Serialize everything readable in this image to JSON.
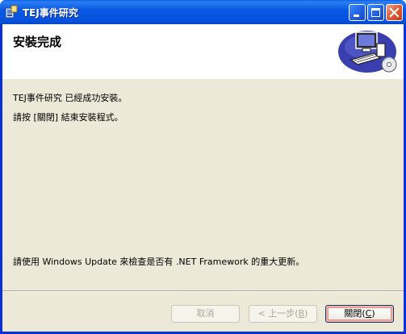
{
  "window": {
    "title": "TEJ事件研究"
  },
  "header": {
    "title": "安裝完成"
  },
  "messages": {
    "installed": "TEJ事件研究 已經成功安裝。",
    "close_hint": "請按 [關閉] 結束安裝程式。",
    "update_hint": "請使用 Windows Update 來檢查是否有 .NET Framework 的重大更新。"
  },
  "buttons": {
    "cancel": "取消",
    "back_prefix": "< 上一步(",
    "back_key": "B",
    "back_suffix": ")",
    "close_prefix": "關閉(",
    "close_key": "C",
    "close_suffix": ")"
  },
  "icons": {
    "app": "installer-icon",
    "header_art": "computer-cd-icon",
    "minimize": "minimize-icon",
    "maximize": "maximize-icon",
    "close": "close-icon"
  },
  "colors": {
    "titlebar": "#0b59e3",
    "client_bg": "#ece9d8",
    "close_red": "#e2603a",
    "accent_blue": "#0831d9"
  }
}
